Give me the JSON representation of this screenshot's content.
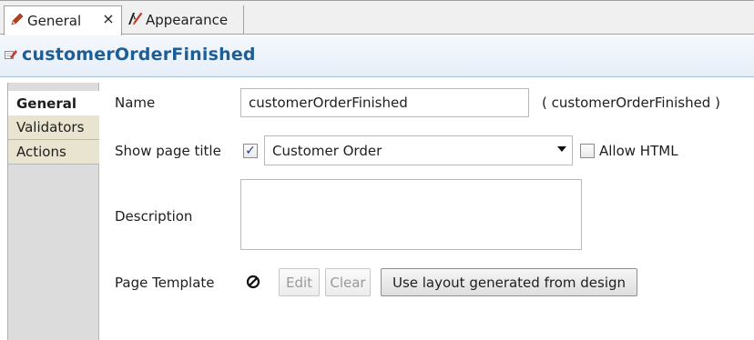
{
  "tabs": [
    {
      "label": "General",
      "icon": "pencil-icon",
      "active": true,
      "closable": true,
      "close_glyph": "×"
    },
    {
      "label": "Appearance",
      "icon": "appearance-icon",
      "active": false
    }
  ],
  "header": {
    "title": "customerOrderFinished",
    "icon": "page-icon"
  },
  "sidebar": {
    "items": [
      {
        "label": "General",
        "selected": true
      },
      {
        "label": "Validators",
        "selected": false
      },
      {
        "label": "Actions",
        "selected": false
      }
    ]
  },
  "form": {
    "name": {
      "label": "Name",
      "value": "customerOrderFinished",
      "hint": "( customerOrderFinished )"
    },
    "show_page_title": {
      "label": "Show page title",
      "checked": true,
      "value": "Customer Order",
      "allow_html_label": "Allow HTML",
      "allow_html_checked": false
    },
    "description": {
      "label": "Description",
      "value": ""
    },
    "page_template": {
      "label": "Page Template",
      "edit_label": "Edit",
      "clear_label": "Clear",
      "layout_button_label": "Use layout generated from design"
    }
  },
  "colors": {
    "header_title": "#1e5e97",
    "sidebar_tab_bg": "#e8e4cf",
    "checkbox_tick": "#1f3c86"
  }
}
